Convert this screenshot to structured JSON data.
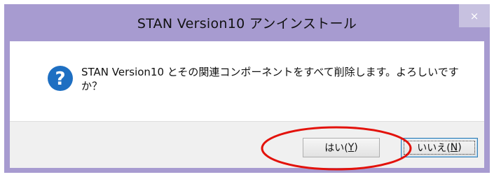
{
  "dialog": {
    "title": "STAN Version10 アンインストール",
    "close_glyph": "×",
    "message_line1": "STAN Version10 とその関連コンポーネントをすべて削除します。よろしいです",
    "message_line2": "か？",
    "icon": "question-icon",
    "buttons": {
      "yes_label": "はい(",
      "yes_key": "Y",
      "yes_close": ")",
      "no_label": "いいえ(",
      "no_key": "N",
      "no_close": ")"
    }
  },
  "colors": {
    "title_bar": "#a79bd0",
    "icon_blue": "#1e6fc2",
    "annotation_red": "#e3120b"
  }
}
